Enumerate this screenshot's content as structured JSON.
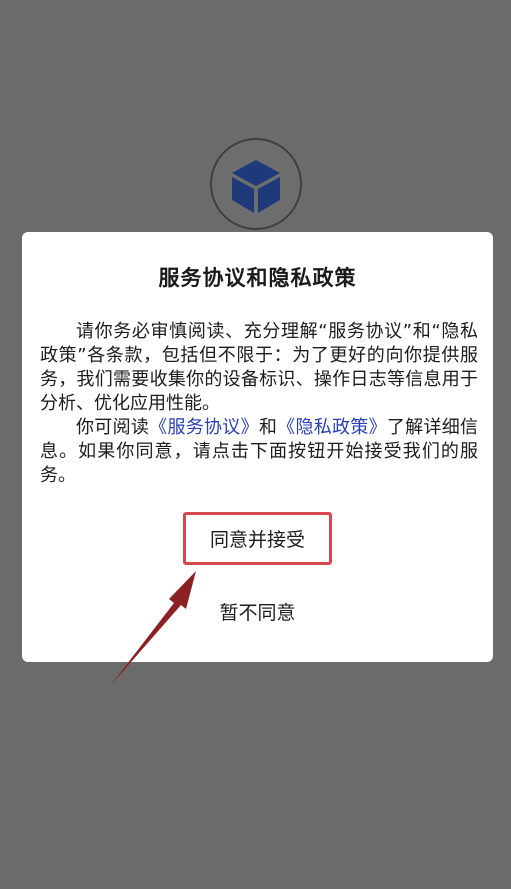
{
  "dialog": {
    "title": "服务协议和隐私政策",
    "paragraph1": "请你务必审慎阅读、充分理解“服务协议”和“隐私政策”各条款，包括但不限于：为了更好的向你提供服务，我们需要收集你的设备标识、操作日志等信息用于分析、优化应用性能。",
    "p2_prefix": "你可阅读",
    "link_service": "《服务协议》",
    "p2_and": "和",
    "link_privacy": "《隐私政策》",
    "p2_suffix": "了解详细信息。如果你同意，请点击下面按钮开始接受我们的服务。",
    "agree_label": "同意并接受",
    "disagree_label": "暂不同意"
  },
  "colors": {
    "overlay": "#6b6b6b",
    "logo_blue": "#1e3a7a",
    "link": "#2b3fb3",
    "highlight": "#d8474d",
    "arrow": "#8b2025"
  },
  "icons": {
    "logo": "cube-logo-icon",
    "arrow": "annotation-arrow-icon"
  }
}
